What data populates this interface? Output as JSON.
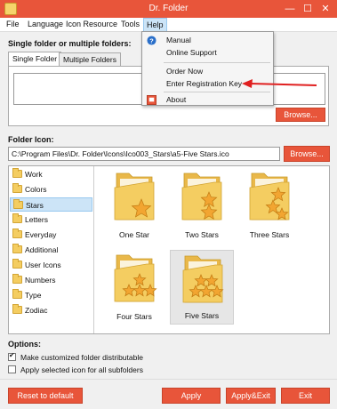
{
  "window": {
    "title": "Dr. Folder",
    "minimize_glyph": "—",
    "maximize_glyph": "☐",
    "close_glyph": "✕"
  },
  "menu": [
    "File",
    "Language",
    "Icon Resource",
    "Tools",
    "Help"
  ],
  "help_menu": {
    "items": [
      {
        "label": "Manual",
        "icon": "help-circle-icon"
      },
      {
        "label": "Online Support",
        "icon": ""
      },
      {
        "label": "Order Now",
        "icon": ""
      },
      {
        "label": "Enter Registration Key",
        "icon": ""
      },
      {
        "label": "About",
        "icon": "about-icon"
      }
    ]
  },
  "folders_section": {
    "label": "Single folder or multiple folders:",
    "tabs": [
      "Single Folder",
      "Multiple Folders"
    ],
    "browse_label": "Browse..."
  },
  "icon_section": {
    "label": "Folder Icon:",
    "path_value": "C:\\Program Files\\Dr. Folder\\Icons\\Ico003_Stars\\a5-Five Stars.ico",
    "browse_label": "Browse..."
  },
  "categories": [
    "Work",
    "Colors",
    "Stars",
    "Letters",
    "Everyday",
    "Additional",
    "User Icons",
    "Numbers",
    "Type",
    "Zodiac"
  ],
  "selected_category": "Stars",
  "icons": [
    {
      "label": "One Star",
      "stars": 1
    },
    {
      "label": "Two Stars",
      "stars": 2
    },
    {
      "label": "Three Stars",
      "stars": 3
    },
    {
      "label": "Four Stars",
      "stars": 4
    },
    {
      "label": "Five Stars",
      "stars": 5
    }
  ],
  "selected_icon": "Five Stars",
  "options": {
    "label": "Options:",
    "make_distributable": {
      "label": "Make customized folder distributable",
      "checked": true
    },
    "apply_subfolders": {
      "label": "Apply selected icon for all subfolders",
      "checked": false
    }
  },
  "footer": {
    "reset_label": "Reset to default",
    "apply_label": "Apply",
    "apply_exit_label": "Apply&Exit",
    "exit_label": "Exit"
  },
  "colors": {
    "accent": "#e8553a",
    "folder": "#f4cd61",
    "star": "#f2a531",
    "selection": "#cce4f7",
    "arrow": "#e02020"
  }
}
